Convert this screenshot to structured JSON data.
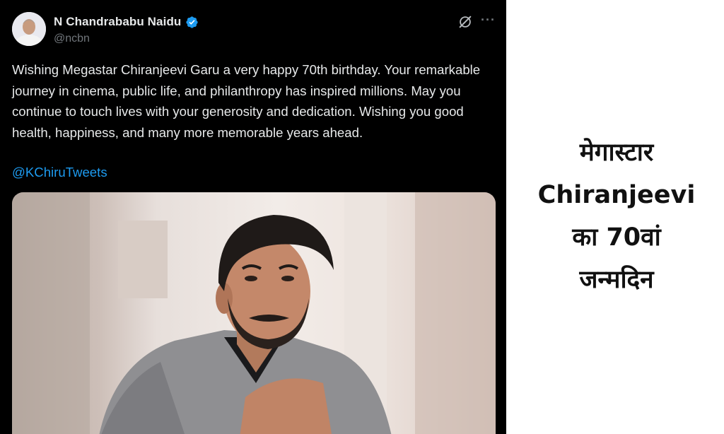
{
  "tweet": {
    "author_name": "N Chandrababu Naidu",
    "author_handle": "@ncbn",
    "body": "Wishing Megastar Chiranjeevi Garu a very happy 70th birthday. Your remarkable journey in cinema, public life, and philanthropy has inspired millions. May you continue to touch lives with your generosity and dedication. Wishing you good health, happiness, and many more memorable years ahead.",
    "mention": "@KChiruTweets",
    "more_icon_glyph": "···",
    "verified_icon": "verified-badge-icon",
    "grok_icon": "grok-icon",
    "colors": {
      "background": "#000000",
      "text": "#e7e9ea",
      "muted": "#71767b",
      "link": "#1d9bf0",
      "verified": "#1d9bf0"
    }
  },
  "headline": {
    "line1": "मेगास्टार",
    "line2": "Chiranjeevi",
    "line3": "का 70वां",
    "line4": "जन्मदिन"
  }
}
